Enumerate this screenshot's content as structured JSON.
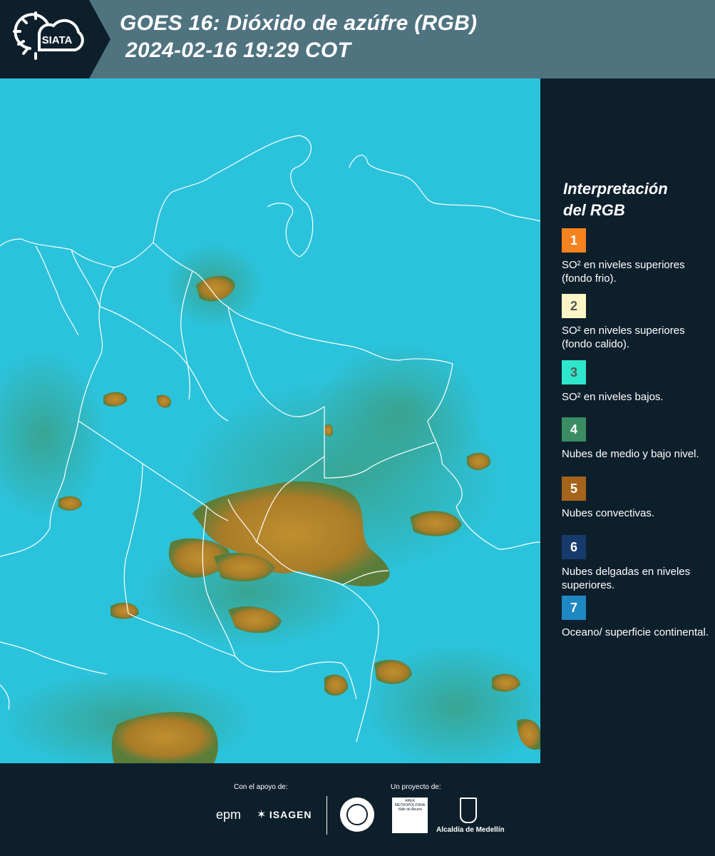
{
  "header": {
    "logo_text": "SIATA",
    "title_line1": "GOES 16: Dióxido de azúfre (RGB)",
    "title_line2": "2024-02-16 19:29 COT"
  },
  "map": {
    "background_color": "#29c4dc",
    "cloud_color": "#b6862a",
    "border_color": "#ffffff"
  },
  "legend": {
    "title_line1": "Interpretación",
    "title_line2": "del RGB",
    "items": [
      {
        "number": "1",
        "color": "#f5821f",
        "text": "SO² en niveles superiores (fondo frio)."
      },
      {
        "number": "2",
        "color": "#fcf6c6",
        "text": "SO² en niveles superiores (fondo calido)."
      },
      {
        "number": "3",
        "color": "#2ee6cc",
        "text": "SO² en niveles bajos."
      },
      {
        "number": "4",
        "color": "#3a8c63",
        "text": "Nubes de medio y bajo nivel."
      },
      {
        "number": "5",
        "color": "#a5641a",
        "text": "Nubes convectivas."
      },
      {
        "number": "6",
        "color": "#163a6b",
        "text": "Nubes delgadas en niveles superiores."
      },
      {
        "number": "7",
        "color": "#1d88c2",
        "text": "Oceano/ superficie continental."
      }
    ]
  },
  "footer": {
    "support_label": "Con el apoyo de:",
    "project_label": "Un proyecto de:",
    "sponsor1": "epm",
    "sponsor2": "ISAGEN",
    "partner1": "ÁREA METROPOLITANA Valle de Aburrá",
    "partner2": "Alcaldía de Medellín"
  }
}
